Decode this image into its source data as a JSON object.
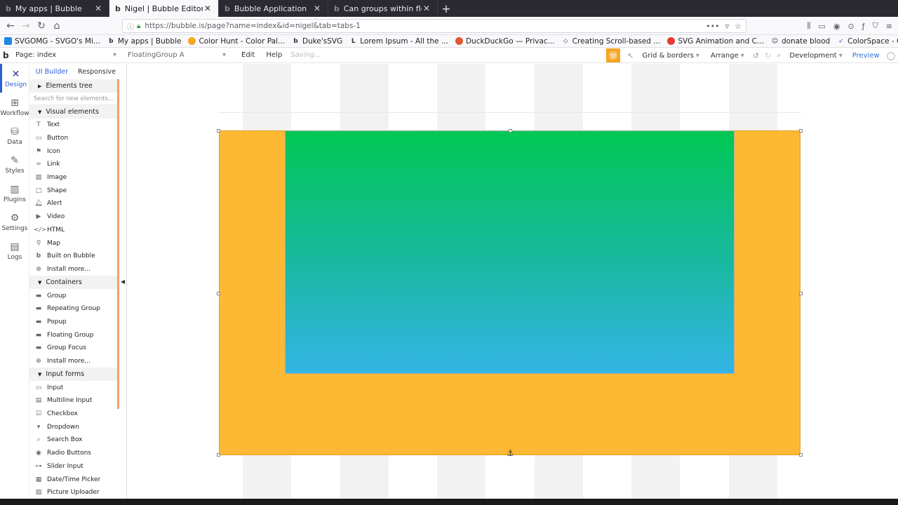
{
  "browser": {
    "tabs": [
      {
        "label": "My apps | Bubble",
        "active": false
      },
      {
        "label": "Nigel | Bubble Editor",
        "active": true
      },
      {
        "label": "Bubble Application",
        "active": false
      },
      {
        "label": "Can groups within floati",
        "active": false
      }
    ],
    "new_tab": "+",
    "url": "https://bubble.is/page?name=index&id=nigel&tab=tabs-1",
    "bookmarks": [
      {
        "label": "SVGOMG - SVGO's Mi...",
        "color": "#1e88e5"
      },
      {
        "label": "My apps | Bubble",
        "color": "#333333"
      },
      {
        "label": "Color Hunt - Color Pal...",
        "color": "#f5a623"
      },
      {
        "label": "Duke'sSVG",
        "color": "#333333"
      },
      {
        "label": "Lorem Ipsum - All the ...",
        "color": "#333333"
      },
      {
        "label": "DuckDuckGo — Privac...",
        "color": "#de5833"
      },
      {
        "label": "Creating Scroll-based ...",
        "color": "#333333"
      },
      {
        "label": "SVG Animation and C...",
        "color": "#e53935"
      },
      {
        "label": "donate blood",
        "color": "#333333"
      },
      {
        "label": "ColorSpace - Color Pa...",
        "color": "#5c6bc0"
      }
    ]
  },
  "editor": {
    "page_selector": "Page: index",
    "element_selector": "FloatingGroup A",
    "menu": [
      "Edit",
      "Help"
    ],
    "saving": "Saving...",
    "grid_borders": "Grid & borders",
    "arrange": "Arrange",
    "environment": "Development",
    "preview": "Preview",
    "accent": "#2b5fd6",
    "gift_color": "#f5a623"
  },
  "tools": [
    {
      "label": "Design",
      "icon": "design-icon",
      "active": true
    },
    {
      "label": "Workflow",
      "icon": "workflow-icon",
      "active": false
    },
    {
      "label": "Data",
      "icon": "data-icon",
      "active": false
    },
    {
      "label": "Styles",
      "icon": "styles-icon",
      "active": false
    },
    {
      "label": "Plugins",
      "icon": "plugins-icon",
      "active": false
    },
    {
      "label": "Settings",
      "icon": "settings-icon",
      "active": false
    },
    {
      "label": "Logs",
      "icon": "logs-icon",
      "active": false
    }
  ],
  "palette": {
    "tabs": [
      "UI Builder",
      "Responsive"
    ],
    "elements_tree": "Elements tree",
    "search_placeholder": "Search for new elements...",
    "visual_header": "Visual elements",
    "visual": [
      "Text",
      "Button",
      "Icon",
      "Link",
      "Image",
      "Shape",
      "Alert",
      "Video",
      "HTML",
      "Map",
      "Built on Bubble",
      "Install more..."
    ],
    "containers_header": "Containers",
    "containers": [
      "Group",
      "Repeating Group",
      "Popup",
      "Floating Group",
      "Group Focus",
      "Install more..."
    ],
    "inputs_header": "Input forms",
    "inputs": [
      "Input",
      "Multiline Input",
      "Checkbox",
      "Dropdown",
      "Search Box",
      "Radio Buttons",
      "Slider Input",
      "Date/Time Picker",
      "Picture Uploader"
    ]
  },
  "canvas": {
    "floating_group_color": "#fdb933",
    "inner_group_gradient": [
      "#00c853",
      "#33b5e5"
    ]
  }
}
